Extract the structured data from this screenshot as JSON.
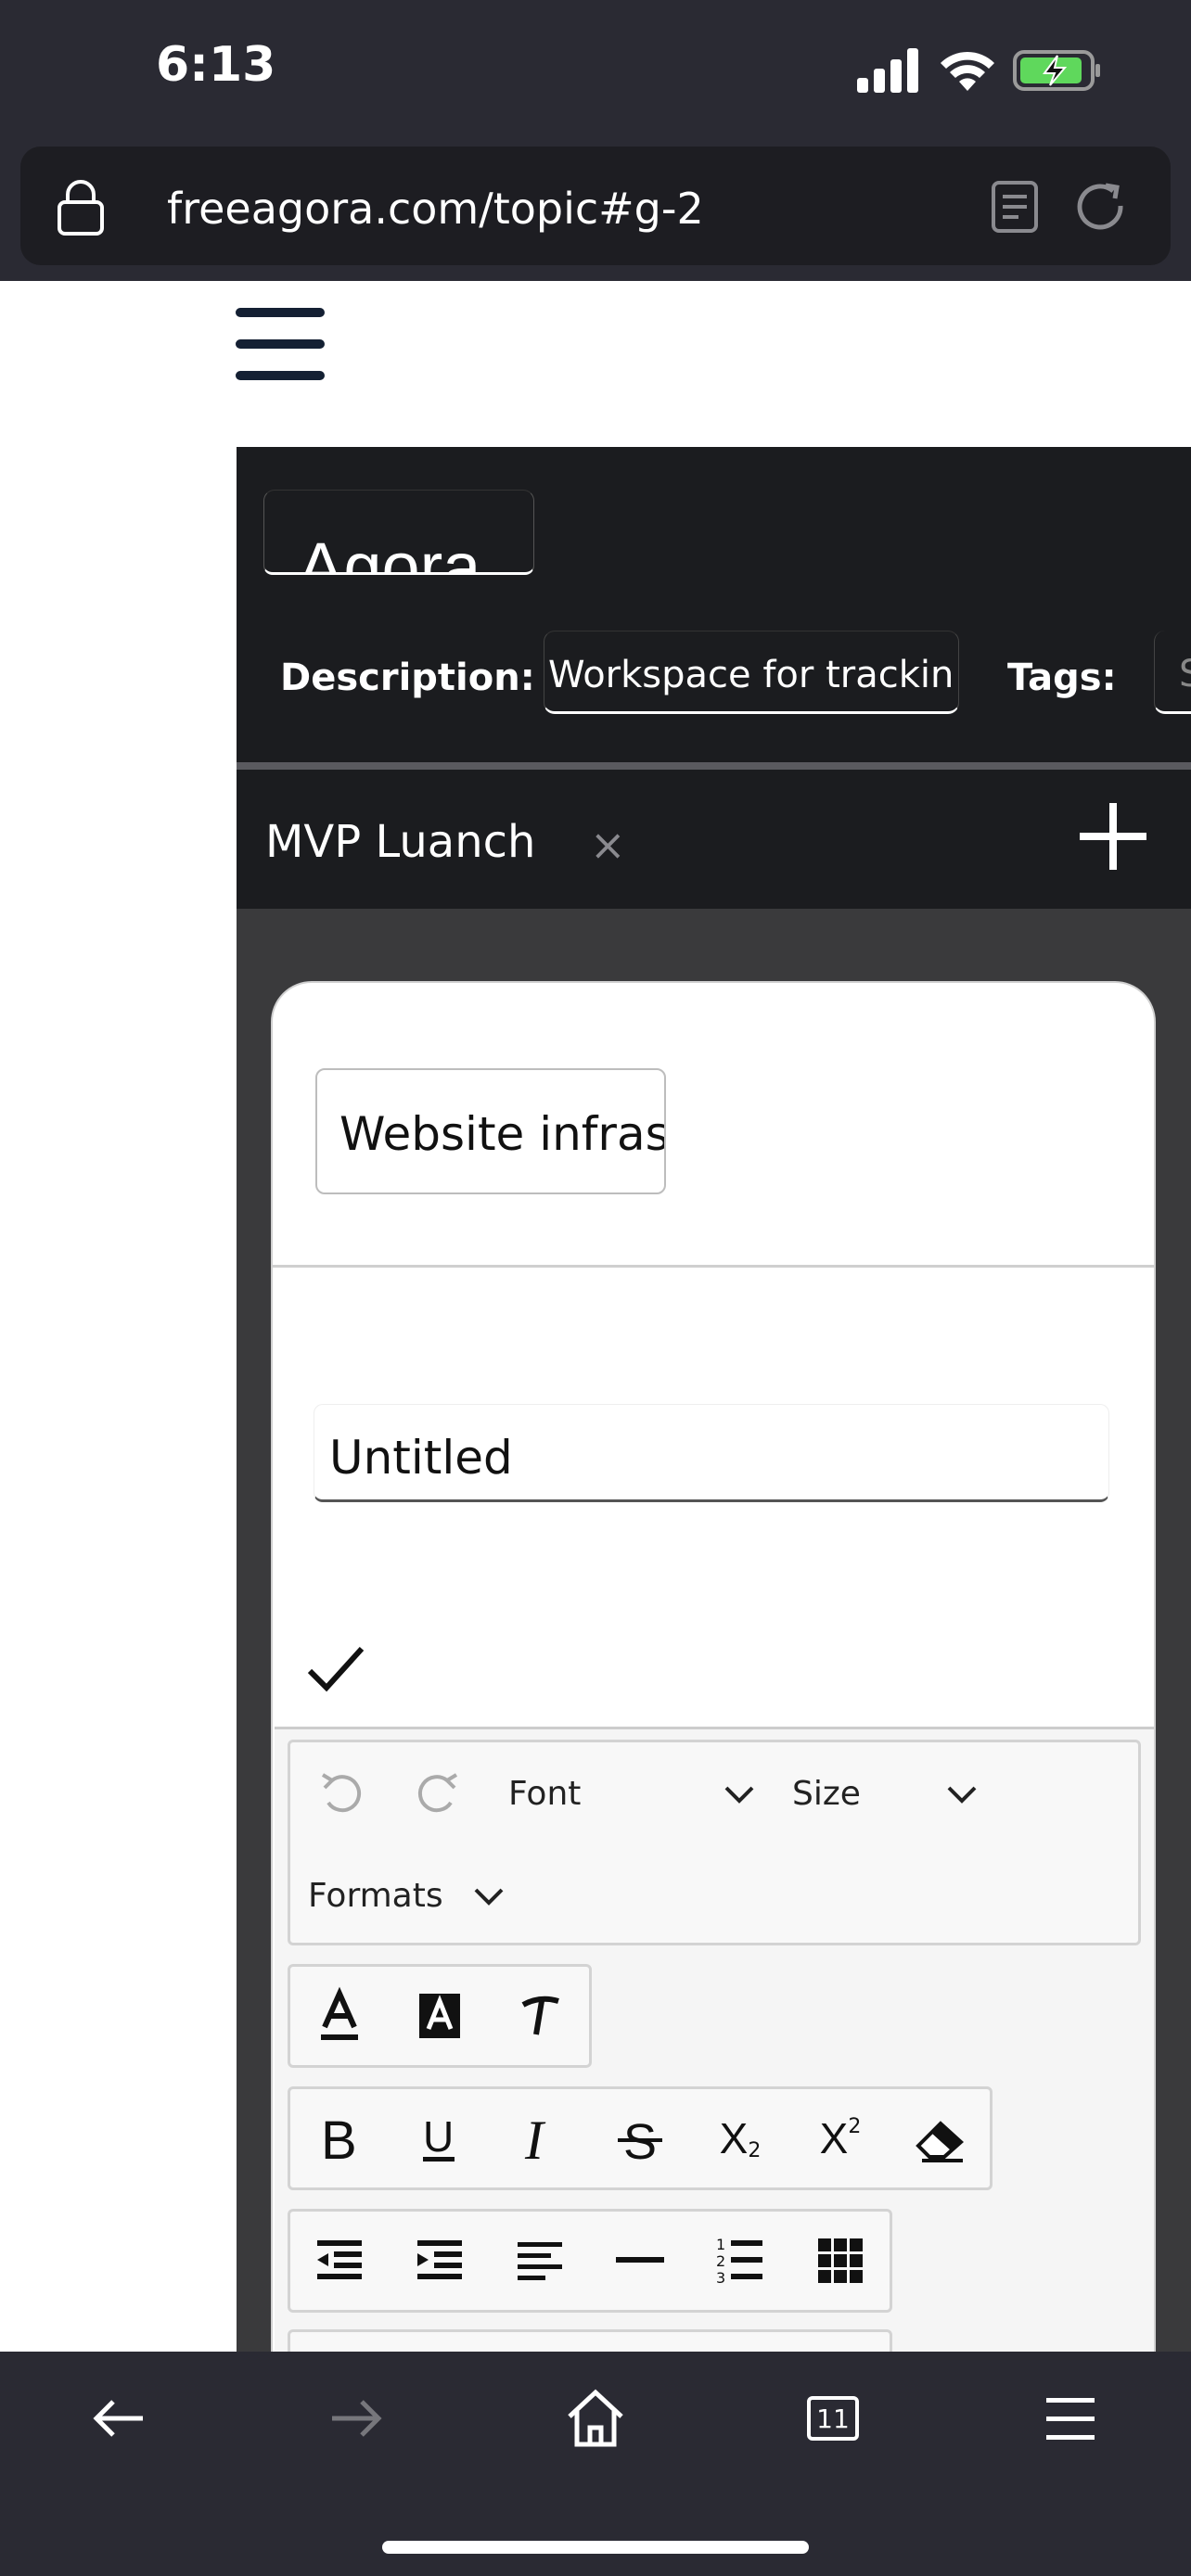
{
  "status": {
    "time": "6:13"
  },
  "browser": {
    "url": "freeagora.com/topic#g-2",
    "tabs_count": "11"
  },
  "header": {
    "title_value": "Agora",
    "description_label": "Description:",
    "description_value": "Workspace for trackin",
    "tags_label": "Tags:",
    "tags_value": "S"
  },
  "tab": {
    "label": "MVP Luanch",
    "close": "×"
  },
  "card": {
    "title_value": "Website infras",
    "item_value": "Untitled"
  },
  "toolbar": {
    "font_label": "Font",
    "size_label": "Size",
    "formats_label": "Formats",
    "subscript_mark": "2",
    "superscript_mark": "2"
  }
}
